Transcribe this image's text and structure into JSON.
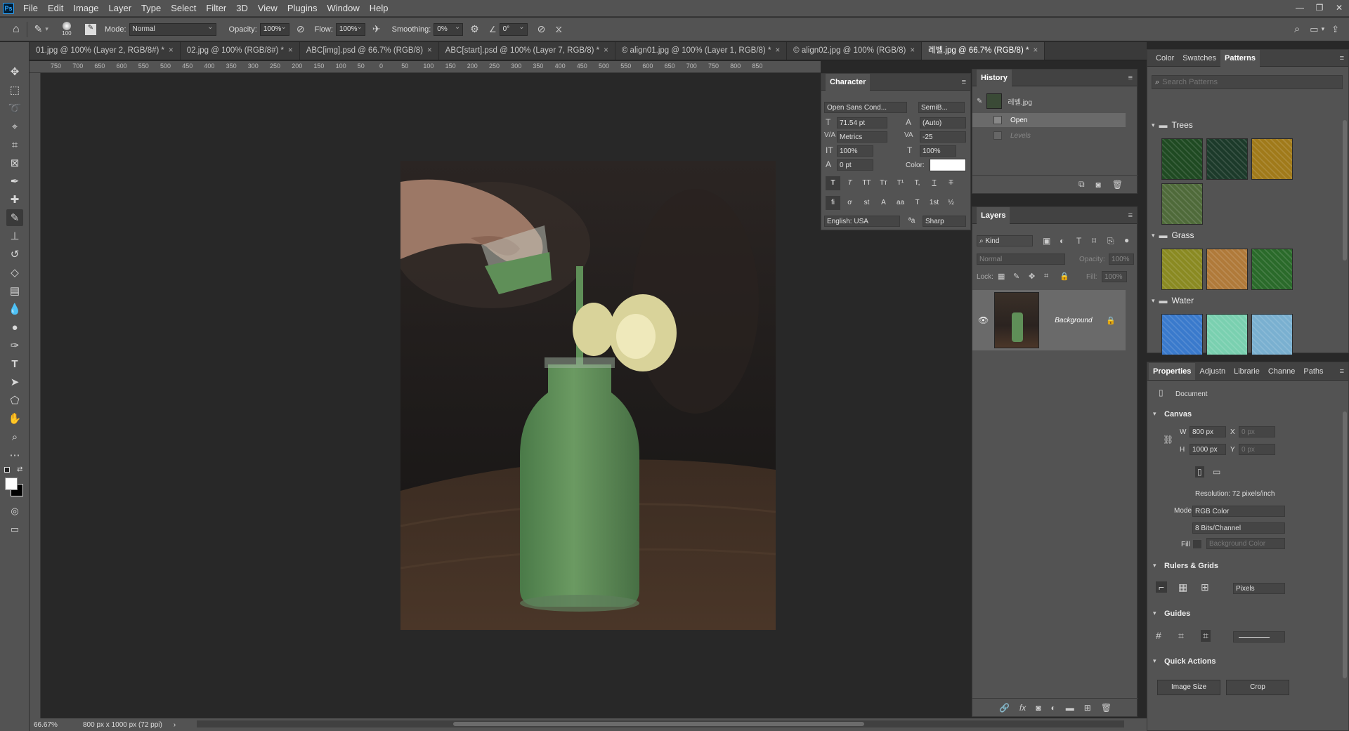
{
  "app": {
    "logo": "Ps"
  },
  "menu": [
    "File",
    "Edit",
    "Image",
    "Layer",
    "Type",
    "Select",
    "Filter",
    "3D",
    "View",
    "Plugins",
    "Window",
    "Help"
  ],
  "options": {
    "brush_size": "100",
    "mode_label": "Mode:",
    "mode_value": "Normal",
    "opacity_label": "Opacity:",
    "opacity_value": "100%",
    "flow_label": "Flow:",
    "flow_value": "100%",
    "smoothing_label": "Smoothing:",
    "smoothing_value": "0%",
    "angle_value": "0°"
  },
  "tabs": [
    {
      "label": "01.jpg @ 100% (Layer 2, RGB/8#) *"
    },
    {
      "label": "02.jpg @ 100% (RGB/8#) *"
    },
    {
      "label": "ABC[img].psd @ 66.7% (RGB/8)"
    },
    {
      "label": "ABC[start].psd @ 100% (Layer 7, RGB/8) *"
    },
    {
      "label": "© align01.jpg @ 100% (Layer 1, RGB/8) *"
    },
    {
      "label": "© align02.jpg @ 100% (RGB/8)"
    },
    {
      "label": "레벨.jpg @ 66.7% (RGB/8) *"
    }
  ],
  "ruler": {
    "h_ticks": [
      "750",
      "700",
      "650",
      "600",
      "550",
      "500",
      "450",
      "400",
      "350",
      "300",
      "250",
      "200",
      "150",
      "100",
      "50",
      "0",
      "50",
      "100",
      "150",
      "200",
      "250",
      "300",
      "350",
      "400",
      "450",
      "500",
      "550",
      "600",
      "650",
      "700",
      "750",
      "800",
      "850"
    ]
  },
  "status": {
    "zoom": "66.67%",
    "doc_info": "800 px x 1000 px (72 ppi)"
  },
  "character": {
    "title": "Character",
    "font_family": "Open Sans Cond...",
    "font_style": "SemiB...",
    "font_size": "71.54 pt",
    "leading": "(Auto)",
    "kerning": "Metrics",
    "tracking": "-25",
    "vscale": "100%",
    "hscale": "100%",
    "baseline": "0 pt",
    "color_label": "Color:",
    "style_buttons": [
      "T",
      "T",
      "TT",
      "Tт",
      "T¹",
      "T,",
      "T",
      "T"
    ],
    "ot_buttons": [
      "fi",
      "ơ",
      "st",
      "A",
      "aa",
      "T",
      "1st",
      "½"
    ],
    "language": "English: USA",
    "aa_label": "ªa",
    "antialias": "Sharp"
  },
  "history": {
    "title": "History",
    "snapshot": "레벨.jpg",
    "items": [
      "Open",
      "Levels"
    ]
  },
  "layers": {
    "title": "Layers",
    "filter_kind": "Kind",
    "blend": "Normal",
    "opacity_label": "Opacity:",
    "opacity_value": "100%",
    "lock_label": "Lock:",
    "fill_label": "Fill:",
    "fill_value": "100%",
    "layer_name": "Background"
  },
  "patterns": {
    "tabs": [
      "Color",
      "Swatches",
      "Patterns"
    ],
    "search_placeholder": "Search Patterns",
    "groups": [
      {
        "name": "Trees",
        "colors": [
          "#1f4a22",
          "#1c3a2a",
          "#a07a1a",
          "#4f6a3a"
        ]
      },
      {
        "name": "Grass",
        "colors": [
          "#8a8a22",
          "#b07a3a",
          "#2a6a2a"
        ]
      },
      {
        "name": "Water",
        "colors": [
          "#3a7acc",
          "#7ad0b0",
          "#7ab0d0"
        ]
      }
    ]
  },
  "properties": {
    "tabs": [
      "Properties",
      "Adjustn",
      "Librarie",
      "Channe",
      "Paths"
    ],
    "document_label": "Document",
    "canvas_section": "Canvas",
    "w_label": "W",
    "w_value": "800 px",
    "h_label": "H",
    "h_value": "1000 px",
    "x_label": "X",
    "x_value": "0 px",
    "y_label": "Y",
    "y_value": "0 px",
    "resolution": "Resolution: 72 pixels/inch",
    "mode_label": "Mode",
    "mode_value": "RGB Color",
    "bits_value": "8 Bits/Channel",
    "fill_label": "Fill",
    "fill_value": "Background Color",
    "rulers_section": "Rulers & Grids",
    "units_value": "Pixels",
    "guides_section": "Guides",
    "quick_section": "Quick Actions",
    "image_size_btn": "Image Size",
    "crop_btn": "Crop"
  },
  "colors": {
    "accent": "#31a8ff",
    "panel": "#535353",
    "canvas_bg": "#282828"
  }
}
